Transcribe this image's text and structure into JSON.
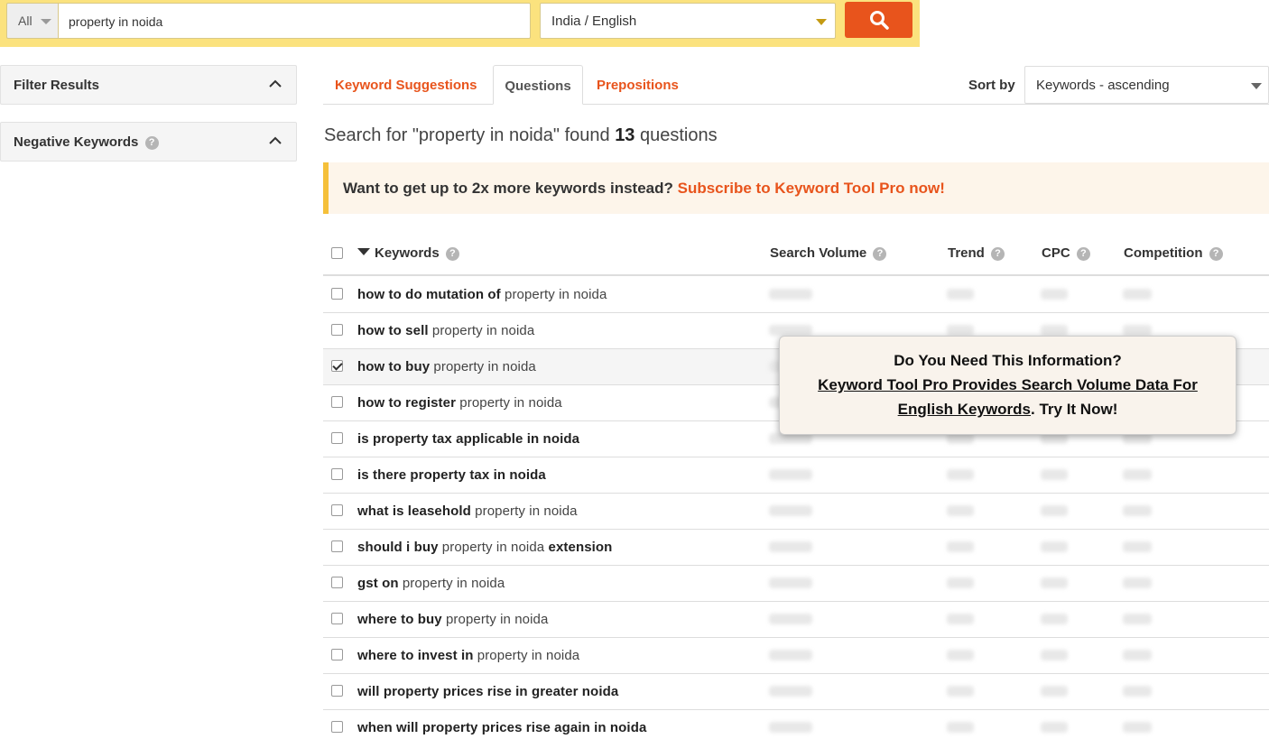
{
  "search": {
    "scope": "All",
    "query": "property in noida",
    "locale": "India / English"
  },
  "sidebar": {
    "filter_results": "Filter Results",
    "negative_keywords": "Negative Keywords"
  },
  "tabs": [
    {
      "label": "Keyword Suggestions",
      "active": false
    },
    {
      "label": "Questions",
      "active": true
    },
    {
      "label": "Prepositions",
      "active": false
    }
  ],
  "sort": {
    "label": "Sort by",
    "value": "Keywords - ascending"
  },
  "result": {
    "prefix": "Search for \"property in noida\" found",
    "count": "13",
    "suffix": "questions"
  },
  "promo": {
    "text": "Want to get up to 2x more keywords instead?",
    "link": "Subscribe to Keyword Tool Pro now!"
  },
  "table": {
    "headers": {
      "keywords": "Keywords",
      "search_volume": "Search Volume",
      "trend": "Trend",
      "cpc": "CPC",
      "competition": "Competition"
    },
    "rows": [
      {
        "bold": "how to do mutation of",
        "rest": " property in noida",
        "bold2": "",
        "checked": false
      },
      {
        "bold": "how to sell",
        "rest": " property in noida",
        "bold2": "",
        "checked": false
      },
      {
        "bold": "how to buy",
        "rest": " property in noida",
        "bold2": "",
        "checked": true
      },
      {
        "bold": "how to register",
        "rest": " property in noida",
        "bold2": "",
        "checked": false
      },
      {
        "bold": "is property tax applicable in noida",
        "rest": "",
        "bold2": "",
        "checked": false
      },
      {
        "bold": "is there property tax in noida",
        "rest": "",
        "bold2": "",
        "checked": false
      },
      {
        "bold": "what is leasehold",
        "rest": " property in noida",
        "bold2": "",
        "checked": false
      },
      {
        "bold": "should i buy",
        "rest": " property in noida ",
        "bold2": "extension",
        "checked": false
      },
      {
        "bold": "gst on",
        "rest": " property in noida",
        "bold2": "",
        "checked": false
      },
      {
        "bold": "where to buy",
        "rest": " property in noida",
        "bold2": "",
        "checked": false
      },
      {
        "bold": "where to invest in",
        "rest": " property in noida",
        "bold2": "",
        "checked": false
      },
      {
        "bold": "will property prices rise in greater noida",
        "rest": "",
        "bold2": "",
        "checked": false
      },
      {
        "bold": "when will property prices rise again in noida",
        "rest": "",
        "bold2": "",
        "checked": false
      }
    ]
  },
  "popup": {
    "line1": "Do You Need This Information?",
    "link": "Keyword Tool Pro Provides Search Volume Data For English Keywords",
    "suffix": ". Try It Now!"
  },
  "colors": {
    "accent": "#e8541c",
    "searchbar": "#fbe27e",
    "promo_border": "#f5c03a"
  }
}
